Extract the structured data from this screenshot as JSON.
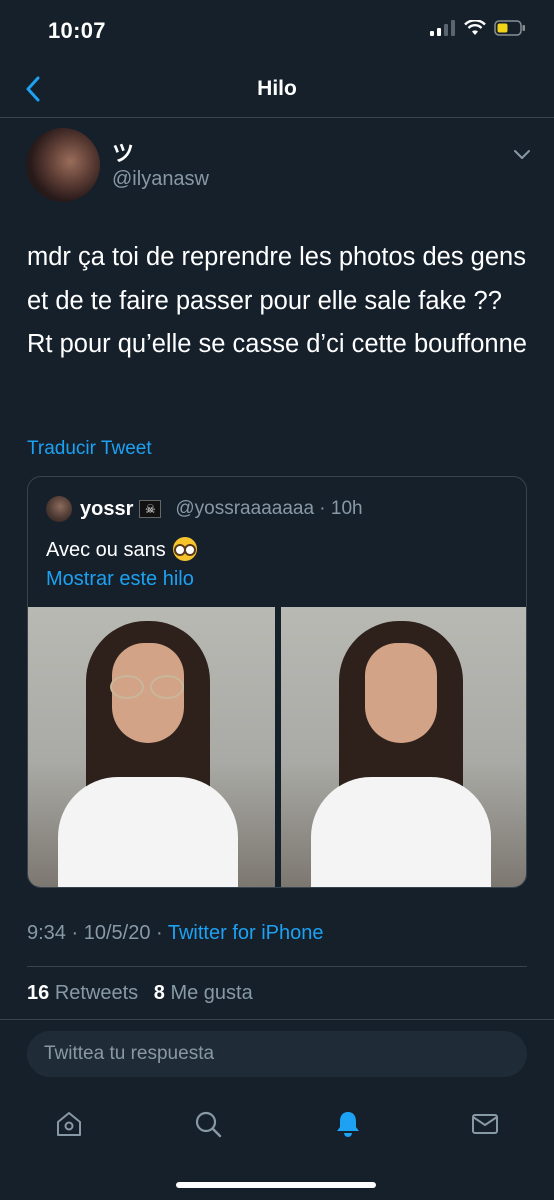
{
  "status": {
    "time": "10:07"
  },
  "nav": {
    "title": "Hilo"
  },
  "tweet": {
    "display_name": "ツ",
    "handle": "@ilyanasw",
    "text": "mdr ça toi de reprendre les photos des gens et de te faire passer pour elle sale fake ?? Rt pour qu’elle se casse d’ci cette bouffonne",
    "translate_label": "Traducir Tweet",
    "time": "9:34",
    "date": "10/5/20",
    "source": "Twitter for iPhone",
    "retweets_count": "16",
    "retweets_label": "Retweets",
    "likes_count": "8",
    "likes_label": "Me gusta"
  },
  "quote": {
    "name": "yossr",
    "flag_icon": "pirate-flag-icon",
    "handle": "@yossraaaaaaa",
    "age": "10h",
    "text": "Avec ou sans",
    "emoji_icon": "nerd-face-emoji",
    "show_thread": "Mostrar este hilo"
  },
  "reply": {
    "placeholder": "Twittea tu respuesta"
  },
  "tabbar": {
    "items": [
      "home-icon",
      "search-icon",
      "notifications-icon",
      "messages-icon"
    ],
    "active": "notifications-icon"
  },
  "colors": {
    "background": "#15202b",
    "accent": "#1da1f2",
    "secondary_text": "#8899a6",
    "divider": "#38444d"
  }
}
